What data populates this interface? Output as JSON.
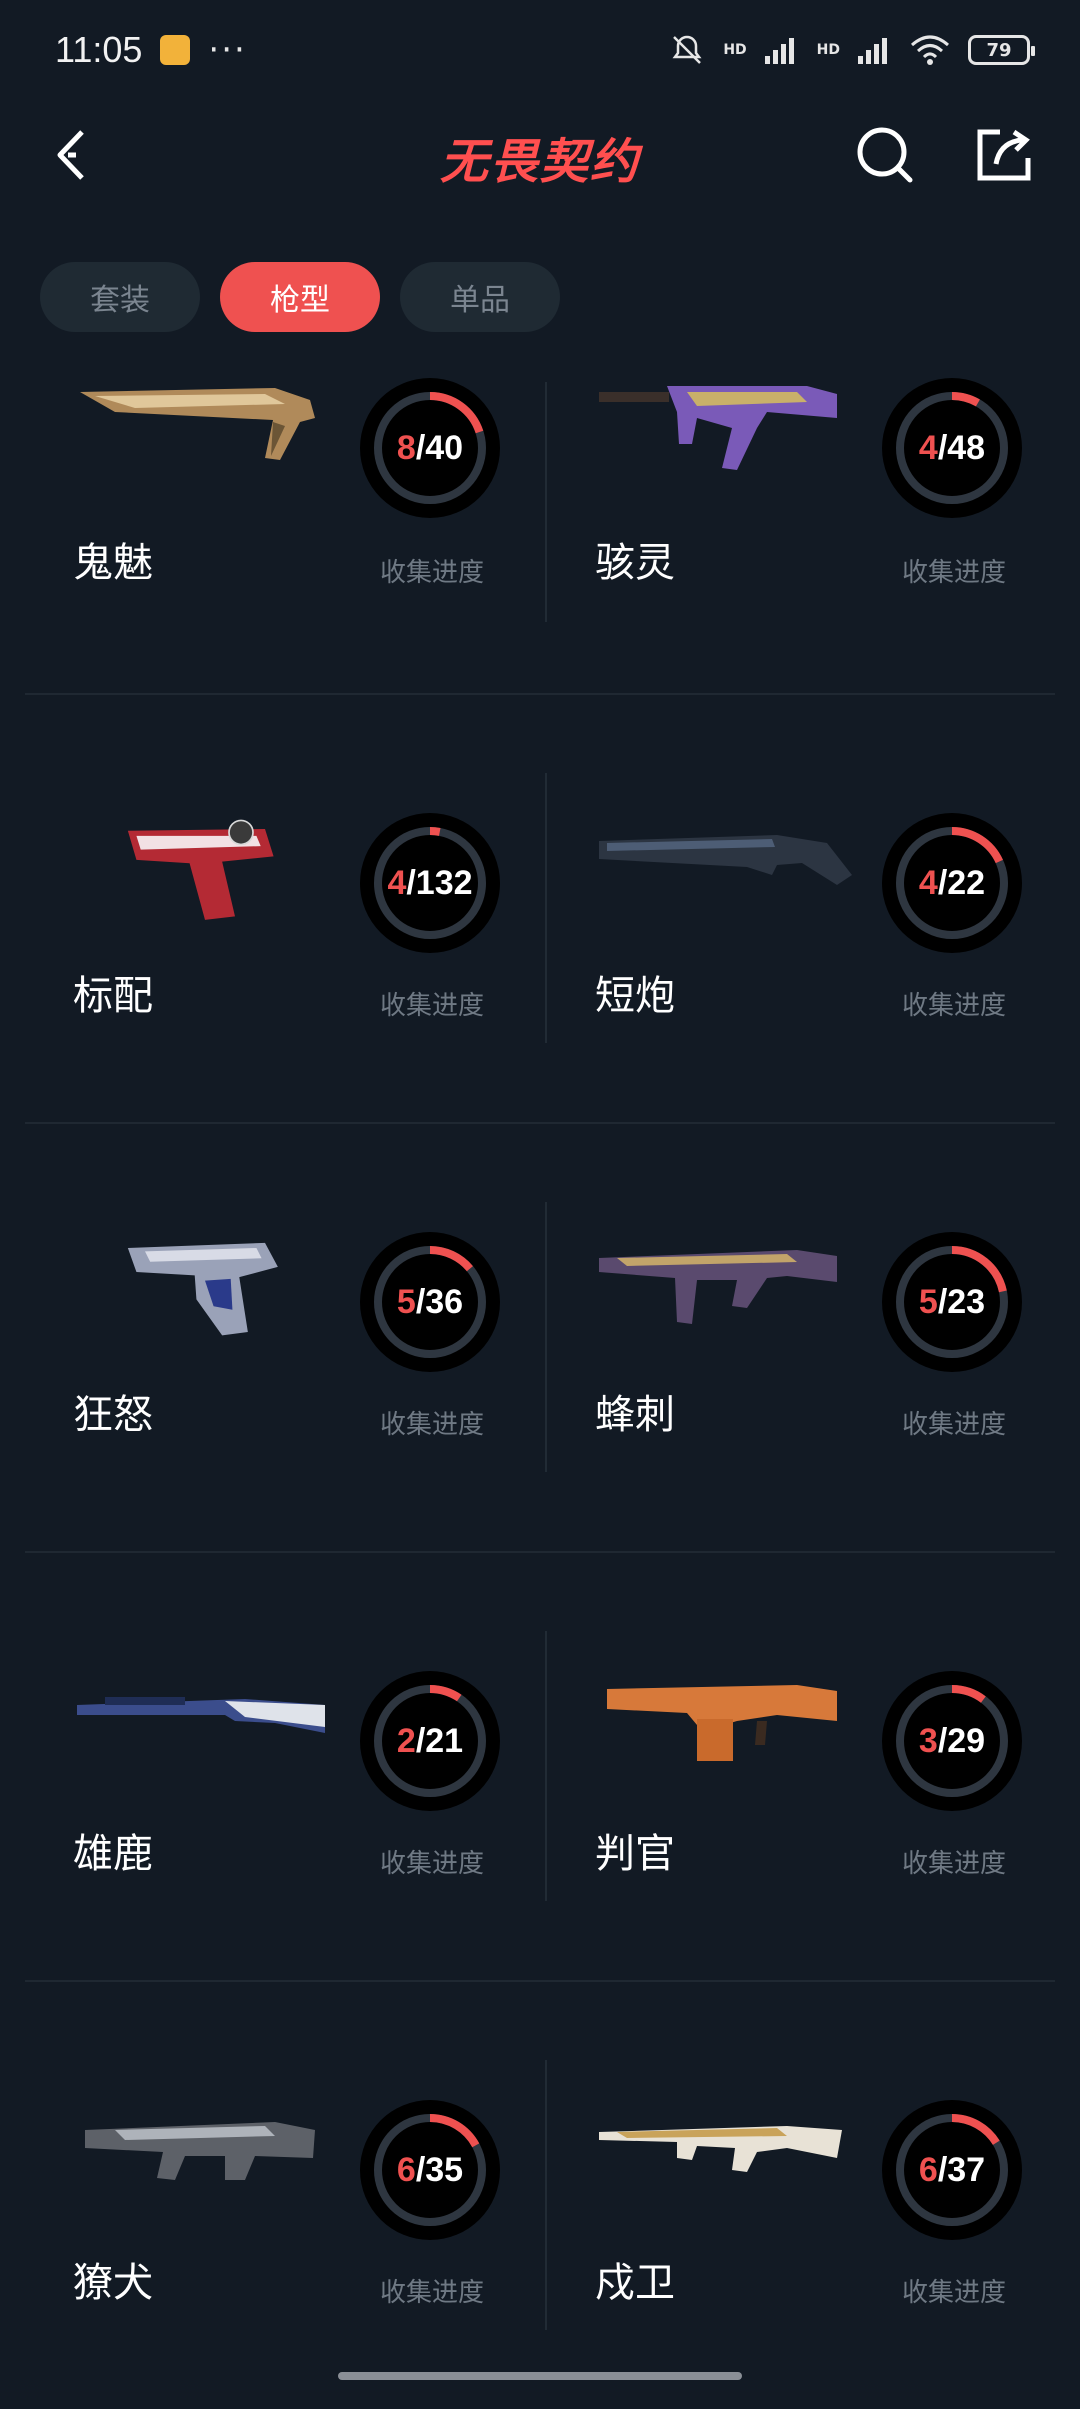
{
  "status_bar": {
    "time": "11:05",
    "more": "···",
    "signal_label_1": "HD",
    "signal_label_2": "HD",
    "battery": "79"
  },
  "header": {
    "logo_text": "无畏契约"
  },
  "tabs": [
    {
      "label": "套装",
      "active": false
    },
    {
      "label": "枪型",
      "active": true
    },
    {
      "label": "单品",
      "active": false
    }
  ],
  "progress_label": "收集进度",
  "colors": {
    "accent": "#ef5150",
    "background": "#121a24"
  },
  "weapons": [
    {
      "name": "鬼魅",
      "collected": "8",
      "total": "/40",
      "ratio": 0.2
    },
    {
      "name": "骇灵",
      "collected": "4",
      "total": "/48",
      "ratio": 0.083
    },
    {
      "name": "标配",
      "collected": "4",
      "total": "/132",
      "ratio": 0.03
    },
    {
      "name": "短炮",
      "collected": "4",
      "total": "/22",
      "ratio": 0.182
    },
    {
      "name": "狂怒",
      "collected": "5",
      "total": "/36",
      "ratio": 0.139
    },
    {
      "name": "蜂刺",
      "collected": "5",
      "total": "/23",
      "ratio": 0.217
    },
    {
      "name": "雄鹿",
      "collected": "2",
      "total": "/21",
      "ratio": 0.095
    },
    {
      "name": "判官",
      "collected": "3",
      "total": "/29",
      "ratio": 0.103
    },
    {
      "name": "獠犬",
      "collected": "6",
      "total": "/35",
      "ratio": 0.171
    },
    {
      "name": "戍卫",
      "collected": "6",
      "total": "/37",
      "ratio": 0.162
    }
  ]
}
